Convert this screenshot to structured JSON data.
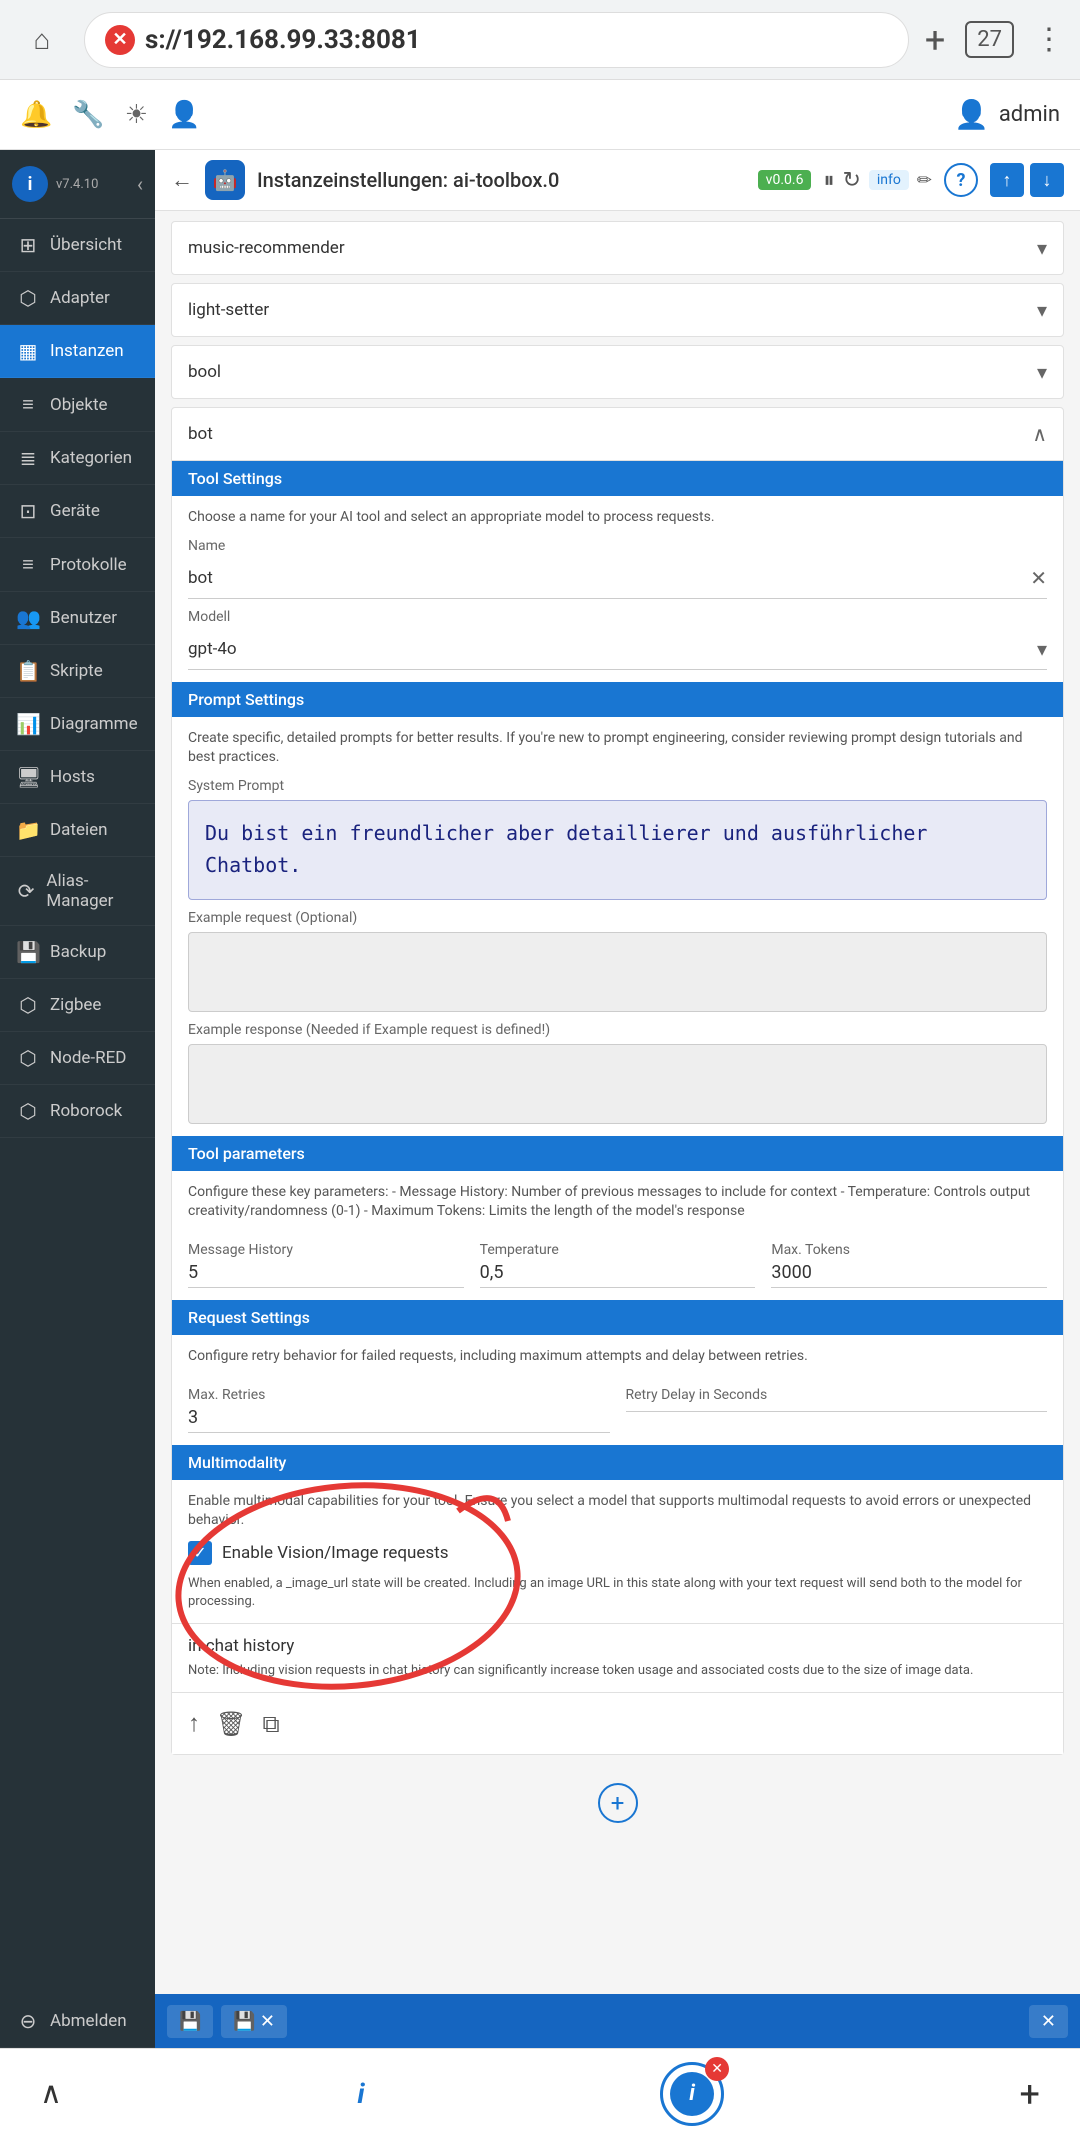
{
  "browser": {
    "url": "s://192.168.99.33:8081",
    "url_bold": "8081",
    "tab_count": "27",
    "error_icon": "✕",
    "new_tab_icon": "+",
    "menu_icon": "⋮",
    "home_icon": "⌂"
  },
  "topnav": {
    "notification_icon": "🔔",
    "settings_icon": "🔧",
    "brightness_icon": "☀",
    "profile_icon": "👤",
    "username": "admin",
    "person_icon": "👤"
  },
  "sidebar": {
    "logo_letter": "i",
    "version": "v7.4.10",
    "collapse_icon": "‹",
    "items": [
      {
        "id": "uebersicht",
        "label": "Übersicht",
        "icon": "⊞"
      },
      {
        "id": "adapter",
        "label": "Adapter",
        "icon": "⬡"
      },
      {
        "id": "instanzen",
        "label": "Instanzen",
        "icon": "▦",
        "active": true
      },
      {
        "id": "objekte",
        "label": "Objekte",
        "icon": "≡"
      },
      {
        "id": "kategorien",
        "label": "Kategorien",
        "icon": "≣"
      },
      {
        "id": "geraete",
        "label": "Geräte",
        "icon": "⊡"
      },
      {
        "id": "protokolle",
        "label": "Protokolle",
        "icon": "≡"
      },
      {
        "id": "benutzer",
        "label": "Benutzer",
        "icon": "👥"
      },
      {
        "id": "skripte",
        "label": "Skripte",
        "icon": "📋"
      },
      {
        "id": "diagramme",
        "label": "Diagramme",
        "icon": "📊"
      },
      {
        "id": "hosts",
        "label": "Hosts",
        "icon": "🖥"
      },
      {
        "id": "dateien",
        "label": "Dateien",
        "icon": "📁"
      },
      {
        "id": "alias-manager",
        "label": "Alias-Manager",
        "icon": "⟳"
      },
      {
        "id": "backup",
        "label": "Backup",
        "icon": "💾"
      },
      {
        "id": "zigbee",
        "label": "Zigbee",
        "icon": "⬡"
      },
      {
        "id": "node-red",
        "label": "Node-RED",
        "icon": "⬡"
      },
      {
        "id": "roborock",
        "label": "Roborock",
        "icon": "⬡"
      }
    ],
    "logout_label": "Abmelden",
    "logout_icon": "⊖"
  },
  "instance_header": {
    "back_icon": "←",
    "icon": "🤖",
    "title": "Instanzeinstellungen: ai-toolbox.0",
    "version": "v0.0.6",
    "pause_icon": "⏸",
    "refresh_icon": "↻",
    "info_label": "info",
    "edit_icon": "✏",
    "help_label": "?",
    "upload_icon": "↑",
    "download_icon": "↓"
  },
  "dropdowns": [
    {
      "id": "music-recommender",
      "label": "music-recommender",
      "open": false
    },
    {
      "id": "light-setter",
      "label": "light-setter",
      "open": false
    },
    {
      "id": "bool",
      "label": "bool",
      "open": false
    }
  ],
  "bot_section": {
    "header_label": "bot",
    "collapse_icon": "∧",
    "tool_settings": {
      "title": "Tool Settings",
      "desc": "Choose a name for your AI tool and select an appropriate model to process requests.",
      "name_label": "Name",
      "name_value": "bot",
      "model_label": "Modell",
      "model_value": "gpt-4o",
      "clear_icon": "✕",
      "dropdown_icon": "▾"
    },
    "prompt_settings": {
      "title": "Prompt Settings",
      "desc": "Create specific, detailed prompts for better results. If you're new to prompt engineering, consider reviewing prompt design tutorials and best practices.",
      "system_prompt_label": "System Prompt",
      "system_prompt_value": "Du bist ein freundlicher aber\ndetaillierer und ausführlicher Chatbot.",
      "example_request_label": "Example request (Optional)",
      "example_request_value": "",
      "example_response_label": "Example response (Needed if Example request is defined!)",
      "example_response_value": ""
    },
    "tool_parameters": {
      "title": "Tool parameters",
      "desc": "Configure these key parameters: - Message History: Number of previous messages to include for context - Temperature: Controls output creativity/randomness (0-1) - Maximum Tokens: Limits the length of the model's response",
      "message_history_label": "Message History",
      "message_history_value": "5",
      "temperature_label": "Temperature",
      "temperature_value": "0,5",
      "max_tokens_label": "Max. Tokens",
      "max_tokens_value": "3000"
    },
    "request_settings": {
      "title": "Request Settings",
      "desc": "Configure retry behavior for failed requests, including maximum attempts and delay between retries.",
      "max_retries_label": "Max. Retries",
      "max_retries_value": "3",
      "retry_delay_label": "Retry Delay in Seconds",
      "retry_delay_value": ""
    },
    "multimodality": {
      "title": "Multimodality",
      "desc": "Enable multimodal capabilities for your tool. Ensure you select a model that supports multimodal requests to avoid errors or unexpected behavior.",
      "enable_vision_label": "Enable Vision/Image requests",
      "enable_vision_checked": true,
      "vision_desc": "When enabled, a _image_url state will be created. Including an image URL in this state along with your text request will send both to the model for processing.",
      "chat_history_title": "in chat history",
      "chat_history_note": "Note: Including vision requests in chat history can significantly increase token usage and associated costs due to the size of image data."
    },
    "action_icons": {
      "up_icon": "↑",
      "delete_icon": "🗑",
      "copy_icon": "⧉"
    }
  },
  "add_button_label": "+",
  "bottom_toolbar": {
    "save_icon": "💾",
    "save_as_icon": "💾",
    "close_label": "✕",
    "separator": "✕"
  },
  "device_bar": {
    "back_icon": "∧",
    "home_icon": "i",
    "add_icon": "+"
  }
}
